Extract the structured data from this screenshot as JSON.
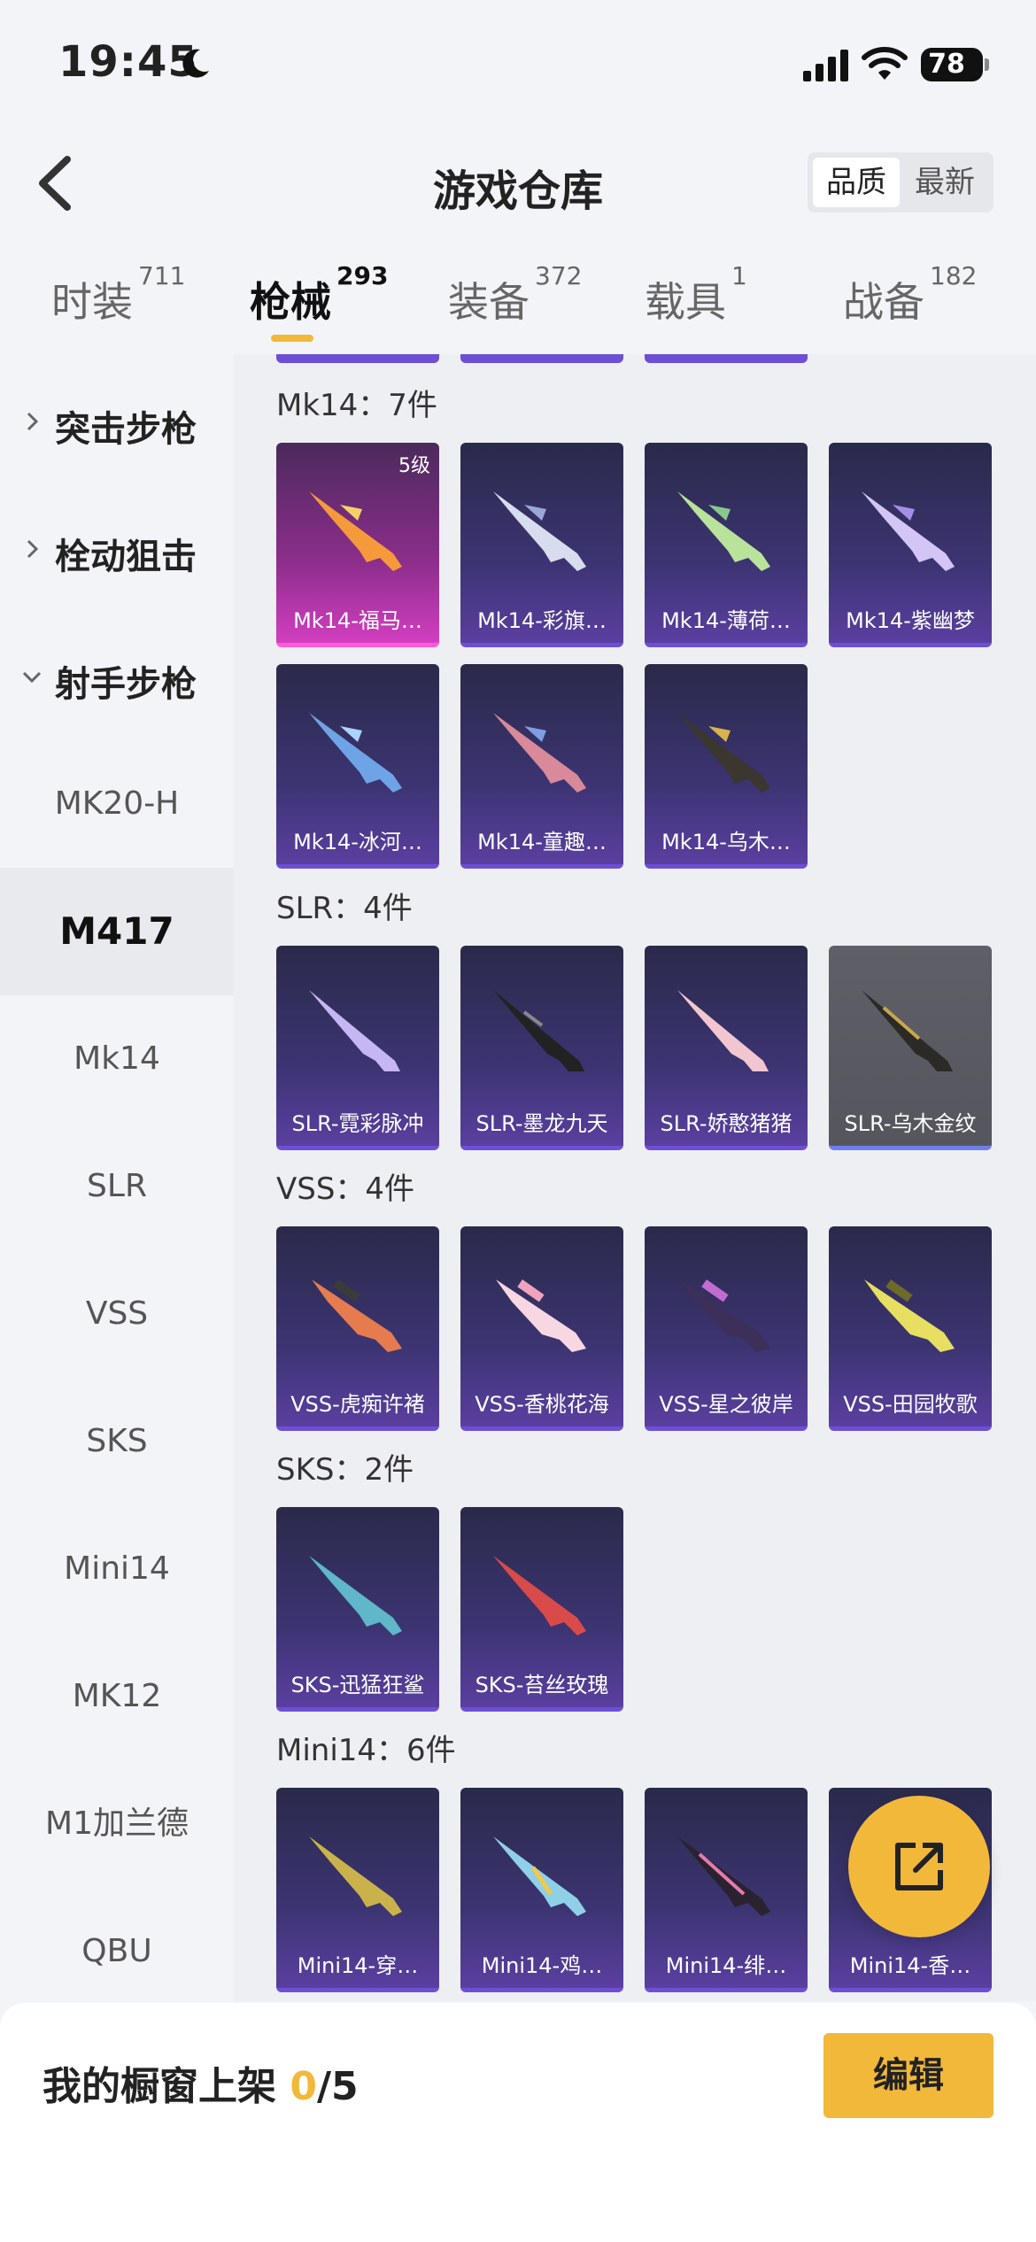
{
  "status": {
    "time": "19:45",
    "battery": "78"
  },
  "header": {
    "title": "游戏仓库",
    "sort_quality": "品质",
    "sort_newest": "最新"
  },
  "tabs": [
    {
      "label": "时装",
      "count": "711"
    },
    {
      "label": "枪械",
      "count": "293"
    },
    {
      "label": "装备",
      "count": "372"
    },
    {
      "label": "载具",
      "count": "1"
    },
    {
      "label": "战备",
      "count": "182"
    }
  ],
  "sidebar": {
    "categories": [
      {
        "label": "突击步枪"
      },
      {
        "label": "栓动狙击"
      },
      {
        "label": "射手步枪"
      }
    ],
    "items": [
      "MK20-H",
      "M417",
      "Mk14",
      "SLR",
      "VSS",
      "SKS",
      "Mini14",
      "MK12",
      "M1加兰德",
      "QBU"
    ]
  },
  "sections": [
    {
      "title": "Mk14：7件",
      "items": [
        "Mk14-福马…",
        "Mk14-彩旗…",
        "Mk14-薄荷…",
        "Mk14-紫幽梦",
        "Mk14-冰河…",
        "Mk14-童趣…",
        "Mk14-乌木…"
      ],
      "level": "5级"
    },
    {
      "title": "SLR：4件",
      "items": [
        "SLR-霓彩脉冲",
        "SLR-墨龙九天",
        "SLR-娇憨猪猪",
        "SLR-乌木金纹"
      ]
    },
    {
      "title": "VSS：4件",
      "items": [
        "VSS-虎痴许褚",
        "VSS-香桃花海",
        "VSS-星之彼岸",
        "VSS-田园牧歌"
      ]
    },
    {
      "title": "SKS：2件",
      "items": [
        "SKS-迅猛狂鲨",
        "SKS-苔丝玫瑰"
      ]
    },
    {
      "title": "Mini14：6件",
      "items": [
        "Mini14-穿…",
        "Mini14-鸡…",
        "Mini14-绯…",
        "Mini14-香…"
      ]
    }
  ],
  "bottom": {
    "label": "我的橱窗上架",
    "count": "0",
    "total": "/5",
    "edit": "编辑"
  },
  "colors": {
    "accent": "#f2b83a",
    "card_purple": "#3c3472",
    "card_pink": "#d23ec0",
    "card_gray": "#55565d"
  }
}
